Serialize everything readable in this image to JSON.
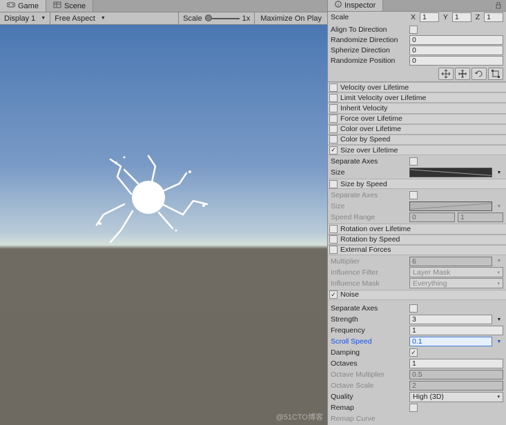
{
  "tabs": {
    "game": "Game",
    "scene": "Scene",
    "inspector": "Inspector"
  },
  "toolbar": {
    "display": "Display 1",
    "aspect": "Free Aspect",
    "scale_label": "Scale",
    "scale_value": "1x",
    "maximize": "Maximize On Play"
  },
  "top": {
    "scale": "Scale",
    "x": "X",
    "xv": "1",
    "y": "Y",
    "yv": "1",
    "z": "Z",
    "zv": "1",
    "align": "Align To Direction",
    "rand_dir": "Randomize Direction",
    "rand_dir_v": "0",
    "spher_dir": "Spherize Direction",
    "spher_dir_v": "0",
    "rand_pos": "Randomize Position",
    "rand_pos_v": "0"
  },
  "modules": {
    "vel_life": "Velocity over Lifetime",
    "lim_vel": "Limit Velocity over Lifetime",
    "inherit": "Inherit Velocity",
    "force": "Force over Lifetime",
    "color_life": "Color over Lifetime",
    "color_speed": "Color by Speed",
    "size_life": "Size over Lifetime",
    "size_life_body": {
      "sep": "Separate Axes",
      "size": "Size"
    },
    "size_speed": "Size by Speed",
    "size_speed_body": {
      "sep": "Separate Axes",
      "size": "Size",
      "range": "Speed Range",
      "r0": "0",
      "r1": "1"
    },
    "rot_life": "Rotation over Lifetime",
    "rot_speed": "Rotation by Speed",
    "ext_forces": "External Forces",
    "ext_body": {
      "mult": "Multiplier",
      "mult_v": "6",
      "filter": "Influence Filter",
      "filter_v": "Layer Mask",
      "mask": "Influence Mask",
      "mask_v": "Everything"
    },
    "noise": "Noise",
    "noise_body": {
      "sep": "Separate Axes",
      "strength": "Strength",
      "strength_v": "3",
      "freq": "Frequency",
      "freq_v": "1",
      "scroll": "Scroll Speed",
      "scroll_v": "0.1",
      "damping": "Damping",
      "octaves": "Octaves",
      "octaves_v": "1",
      "oct_mult": "Octave Multiplier",
      "oct_mult_v": "0.5",
      "oct_scale": "Octave Scale",
      "oct_scale_v": "2",
      "quality": "Quality",
      "quality_v": "High (3D)",
      "remap": "Remap",
      "remap_curve": "Remap Curve"
    }
  },
  "watermark": "@51CTO博客"
}
